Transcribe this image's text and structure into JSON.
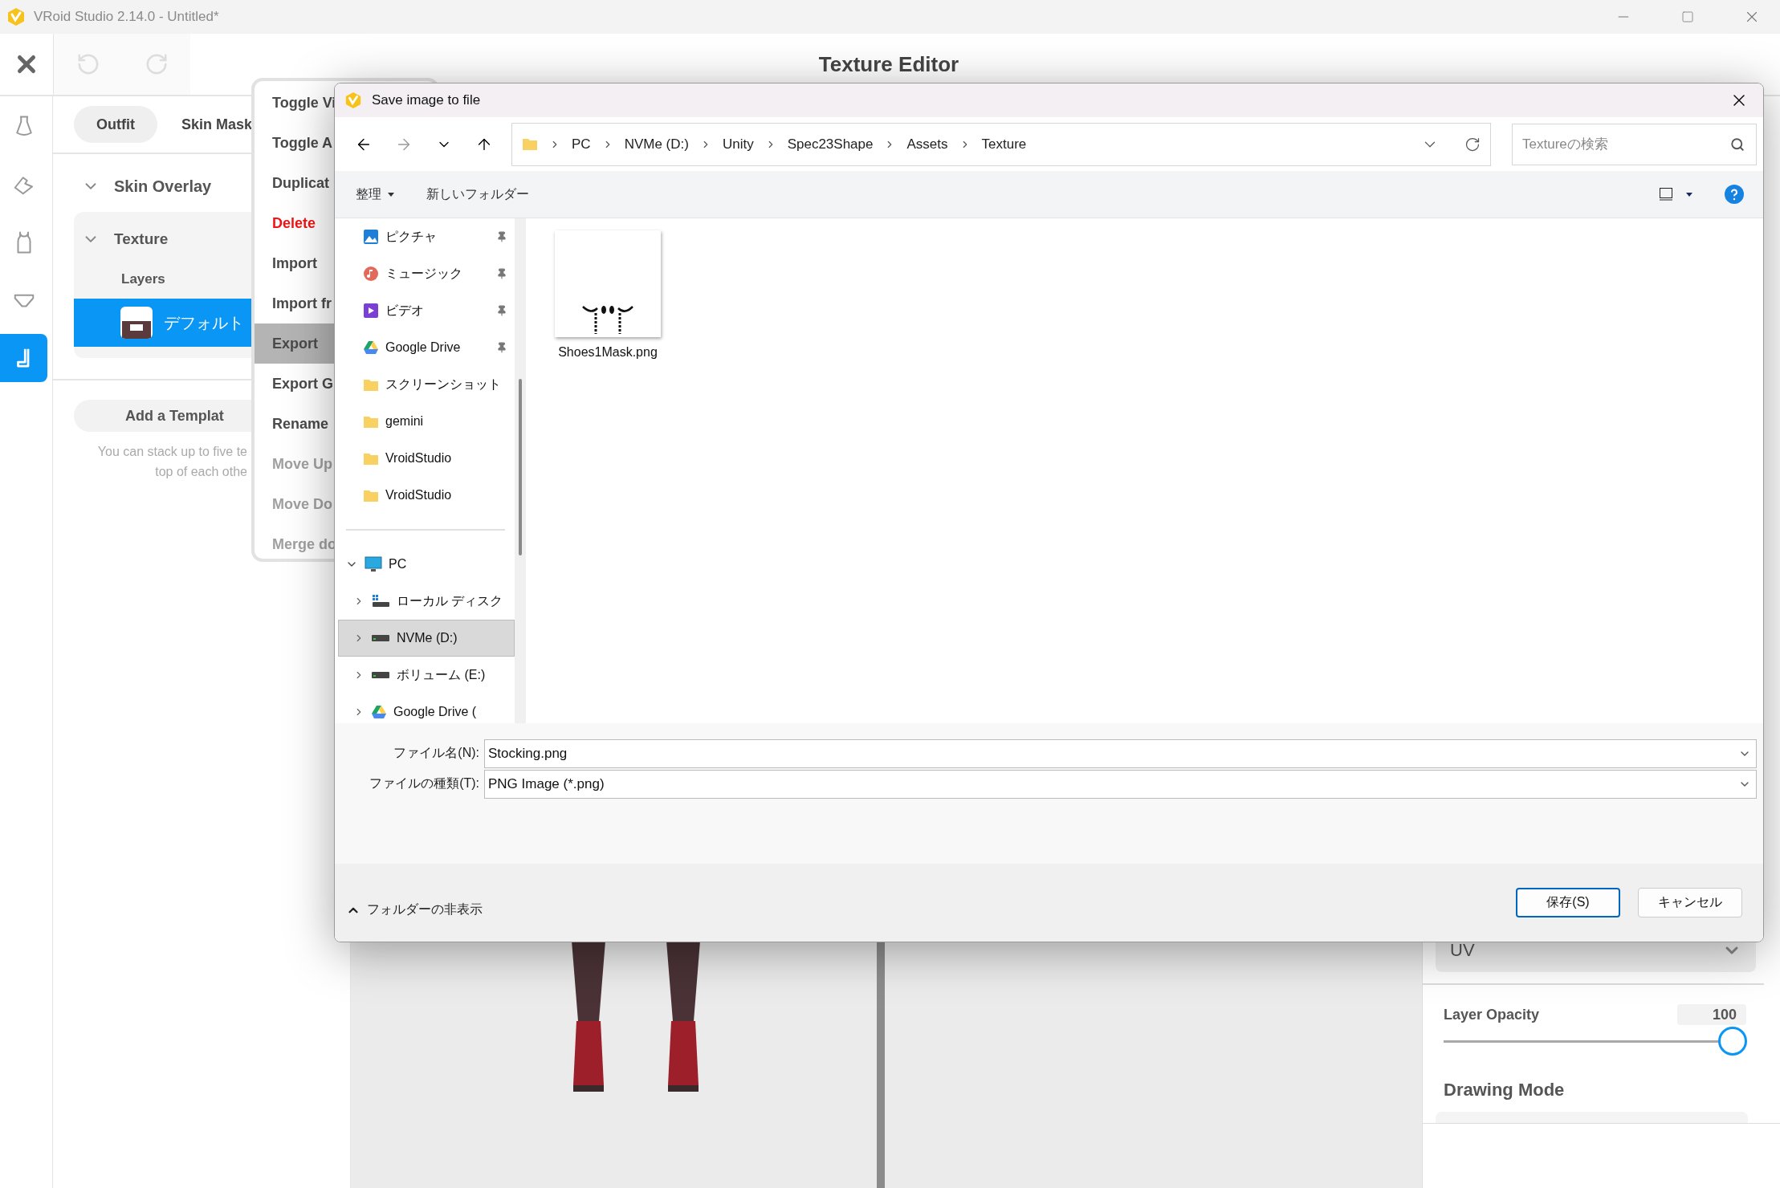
{
  "window": {
    "title": "VRoid Studio 2.14.0 - Untitled*"
  },
  "editor": {
    "title": "Texture Editor"
  },
  "rail": [
    {
      "kind": "dress",
      "selected": false
    },
    {
      "kind": "shoe",
      "selected": false
    },
    {
      "kind": "top",
      "selected": false
    },
    {
      "kind": "underwear",
      "selected": false
    },
    {
      "kind": "sock",
      "selected": true
    }
  ],
  "tabs": [
    {
      "label": "Outfit",
      "selected": true
    },
    {
      "label": "Skin Mask",
      "selected": false
    }
  ],
  "overlay": {
    "label": "Skin Overlay",
    "expanded": true
  },
  "texture": {
    "label": "Texture",
    "expanded": true,
    "layers_heading": "Layers",
    "layers": [
      {
        "name": "デフォルト",
        "selected": true
      }
    ]
  },
  "add_template": "Add a Templat",
  "hint": [
    "You can stack up to five te",
    "top of each othe"
  ],
  "context_menu": [
    {
      "label": "Toggle Vi",
      "kind": "normal",
      "highlighted": false,
      "disabled": false
    },
    {
      "label": "Toggle A",
      "kind": "normal",
      "highlighted": false,
      "disabled": false
    },
    {
      "label": "Duplicat",
      "kind": "normal",
      "highlighted": false,
      "disabled": false
    },
    {
      "label": "Delete",
      "kind": "danger",
      "highlighted": false,
      "disabled": false
    },
    {
      "label": "Import",
      "kind": "normal",
      "highlighted": false,
      "disabled": false
    },
    {
      "label": "Import fr",
      "kind": "normal",
      "highlighted": false,
      "disabled": false
    },
    {
      "label": "Export",
      "kind": "normal",
      "highlighted": true,
      "disabled": false
    },
    {
      "label": "Export G",
      "kind": "normal",
      "highlighted": false,
      "disabled": false
    },
    {
      "label": "Rename",
      "kind": "normal",
      "highlighted": false,
      "disabled": false
    },
    {
      "label": "Move Up",
      "kind": "normal",
      "highlighted": false,
      "disabled": true
    },
    {
      "label": "Move Do",
      "kind": "normal",
      "highlighted": false,
      "disabled": true
    },
    {
      "label": "Merge do",
      "kind": "normal",
      "highlighted": false,
      "disabled": true
    }
  ],
  "dialog": {
    "title": "Save image to file",
    "breadcrumb": [
      "PC",
      "NVMe (D:)",
      "Unity",
      "Spec23Shape",
      "Assets",
      "Texture"
    ],
    "search_placeholder": "Textureの検索",
    "organize": "整理",
    "new_folder": "新しいフォルダー",
    "quick_access": [
      {
        "label": "ピクチャ",
        "kind": "pictures",
        "pinned": true
      },
      {
        "label": "ミュージック",
        "kind": "music",
        "pinned": true
      },
      {
        "label": "ビデオ",
        "kind": "video",
        "pinned": true
      },
      {
        "label": "Google Drive",
        "kind": "cloud",
        "pinned": true
      },
      {
        "label": "スクリーンショット",
        "kind": "folder",
        "pinned": false
      },
      {
        "label": "gemini",
        "kind": "folder",
        "pinned": false
      },
      {
        "label": "VroidStudio",
        "kind": "folder",
        "pinned": false
      },
      {
        "label": "VroidStudio",
        "kind": "folder",
        "pinned": false
      }
    ],
    "pc": {
      "label": "PC",
      "expanded": true,
      "drives": [
        {
          "label": "ローカル ディスク",
          "kind": "system",
          "selected": false
        },
        {
          "label": "NVMe (D:)",
          "kind": "drive",
          "selected": true
        },
        {
          "label": "ボリューム (E:)",
          "kind": "drive",
          "selected": false
        },
        {
          "label": "Google Drive (",
          "kind": "cloud",
          "selected": false
        }
      ]
    },
    "files": [
      {
        "name": "Shoes1Mask.png"
      }
    ],
    "file_name": {
      "label": "ファイル名(N):",
      "value": "Stocking.png"
    },
    "file_type": {
      "label": "ファイルの種類(T):",
      "value": "PNG Image (*.png)"
    },
    "hide_folders": "フォルダーの非表示",
    "buttons": [
      {
        "label": "保存(S)",
        "kind": "primary"
      },
      {
        "label": "キャンセル",
        "kind": "secondary"
      }
    ]
  },
  "right_panel": {
    "uv_select": "UV",
    "layer_opacity": {
      "label": "Layer Opacity",
      "value": "100",
      "level": 1
    },
    "drawing_mode": "Drawing Mode"
  }
}
